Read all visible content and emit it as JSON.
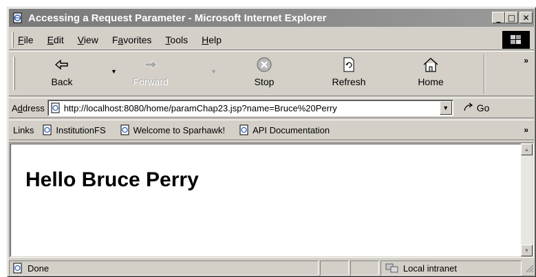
{
  "window": {
    "title": "Accessing a Request Parameter - Microsoft Internet Explorer",
    "controls": {
      "minimize": "_",
      "maximize": "□",
      "close": "✕"
    }
  },
  "menu": {
    "items": [
      {
        "label": "File",
        "key": "F",
        "rest": "ile"
      },
      {
        "label": "Edit",
        "key": "E",
        "rest": "dit"
      },
      {
        "label": "View",
        "key": "V",
        "rest": "iew"
      },
      {
        "label": "Favorites",
        "pre": "F",
        "key": "a",
        "rest": "vorites"
      },
      {
        "label": "Tools",
        "key": "T",
        "rest": "ools"
      },
      {
        "label": "Help",
        "key": "H",
        "rest": "elp"
      }
    ]
  },
  "toolbar": {
    "back": "Back",
    "forward": "Forward",
    "stop": "Stop",
    "refresh": "Refresh",
    "home": "Home",
    "more": "»"
  },
  "address": {
    "label_pre": "A",
    "label_key": "d",
    "label_rest": "dress",
    "value": "http://localhost:8080/home/paramChap23.jsp?name=Bruce%20Perry",
    "go": "Go"
  },
  "links": {
    "label": "Links",
    "items": [
      "InstitutionFS",
      "Welcome to Sparhawk!",
      "API Documentation"
    ],
    "more": "»"
  },
  "page": {
    "greeting": "Hello Bruce Perry"
  },
  "status": {
    "text": "Done",
    "zone": "Local intranet"
  },
  "icons": {
    "title": "ie-page-icon",
    "back": "back-arrow-icon",
    "forward": "forward-arrow-icon",
    "stop": "stop-icon",
    "refresh": "refresh-icon",
    "home": "home-icon",
    "go": "go-arrow-icon",
    "zone": "intranet-icon"
  }
}
